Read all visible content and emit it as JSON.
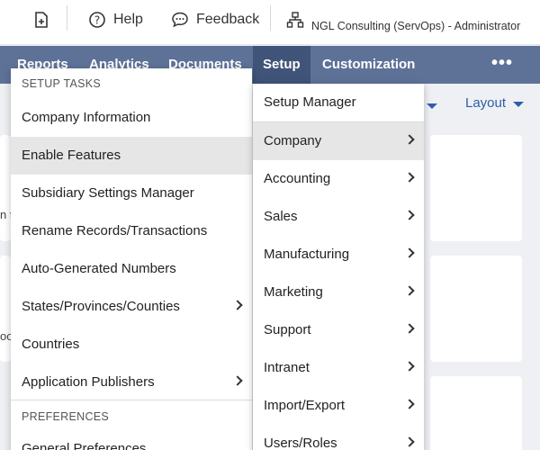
{
  "topbar": {
    "add_icon": "add-document-icon",
    "help_label": "Help",
    "feedback_label": "Feedback",
    "account_text": "NGL Consulting (ServOps) - Administrator"
  },
  "navbar": {
    "items": [
      "Reports",
      "Analytics",
      "Documents",
      "Setup",
      "Customization"
    ],
    "more": "•••",
    "active_item": "Setup",
    "bar_color": "#5e7298",
    "active_color": "#3f5478"
  },
  "page": {
    "layout_label": "Layout",
    "peek_1": "n t",
    "peek_2": "oo"
  },
  "setup_tasks_menu": {
    "heading": "SETUP TASKS",
    "items": [
      "Company Information",
      "Enable Features",
      "Subsidiary Settings Manager",
      "Rename Records/Transactions",
      "Auto-Generated Numbers",
      "States/Provinces/Counties",
      "Countries",
      "Application Publishers"
    ],
    "highlighted_item": "Enable Features",
    "preferences_heading": "PREFERENCES",
    "preferences_items": [
      "General Preferences"
    ]
  },
  "setup_menu": {
    "items": [
      "Setup Manager",
      "Company",
      "Accounting",
      "Sales",
      "Manufacturing",
      "Marketing",
      "Support",
      "Intranet",
      "Import/Export",
      "Users/Roles"
    ],
    "highlighted_item": "Company"
  }
}
